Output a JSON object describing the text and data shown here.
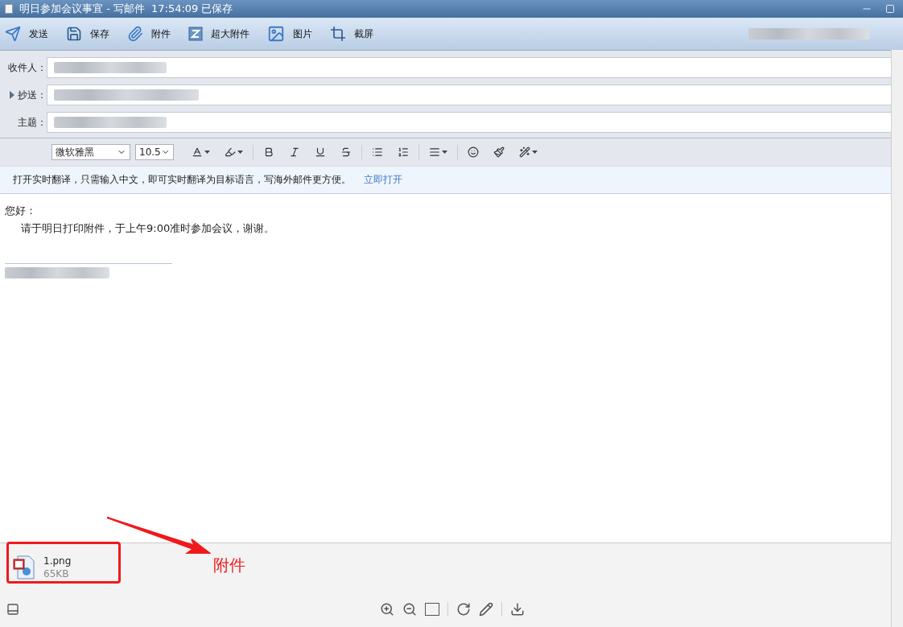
{
  "window": {
    "title": "明日参加会议事宜 - 写邮件",
    "status": "17:54:09 已保存"
  },
  "toolbar": [
    {
      "kind": "send",
      "label": "发送"
    },
    {
      "kind": "save",
      "label": "保存"
    },
    {
      "kind": "attach",
      "label": "附件"
    },
    {
      "kind": "bigattach",
      "label": "超大附件"
    },
    {
      "kind": "image",
      "label": "图片"
    },
    {
      "kind": "screenshot",
      "label": "截屏"
    }
  ],
  "fields": [
    {
      "label": "收件人：",
      "toggle": false
    },
    {
      "label": "抄送：",
      "toggle": true
    },
    {
      "label": "主题：",
      "toggle": false
    }
  ],
  "format_bar": {
    "font": "微软雅黑",
    "size": "10.5",
    "tools": [
      {
        "kind": "color",
        "dropdown": true
      },
      {
        "kind": "highlight",
        "dropdown": true
      },
      {
        "kind": "sep"
      },
      {
        "kind": "bold",
        "dropdown": false
      },
      {
        "kind": "italic",
        "dropdown": false
      },
      {
        "kind": "underline",
        "dropdown": false
      },
      {
        "kind": "strike",
        "dropdown": false
      },
      {
        "kind": "sep"
      },
      {
        "kind": "bullets",
        "dropdown": false
      },
      {
        "kind": "numbers",
        "dropdown": false
      },
      {
        "kind": "sep"
      },
      {
        "kind": "align",
        "dropdown": true
      },
      {
        "kind": "sep"
      },
      {
        "kind": "emoji",
        "dropdown": false
      },
      {
        "kind": "brush",
        "dropdown": false
      },
      {
        "kind": "wand",
        "dropdown": true
      }
    ]
  },
  "translate_bar": {
    "text": "打开实时翻译，只需输入中文，即可实时翻译为目标语言，写海外邮件更方便。",
    "link": "立即打开"
  },
  "body": {
    "greeting": "您好：",
    "message": "请于明日打印附件，于上午9:00准时参加会议，谢谢。"
  },
  "attachments": [
    {
      "name": "1.png",
      "size": "65KB"
    }
  ],
  "annotation": {
    "label": "附件"
  },
  "bottom_tools": [
    {
      "kind": "zoomin"
    },
    {
      "kind": "zoomout"
    },
    {
      "kind": "actual"
    },
    {
      "kind": "sep"
    },
    {
      "kind": "rotate"
    },
    {
      "kind": "edit"
    },
    {
      "kind": "sep"
    },
    {
      "kind": "download"
    }
  ]
}
